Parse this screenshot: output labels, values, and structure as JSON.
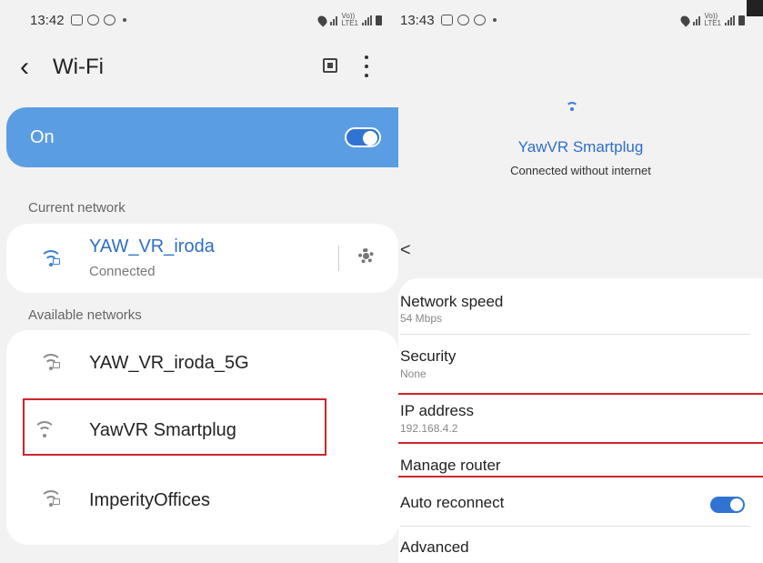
{
  "left": {
    "status": {
      "time": "13:42",
      "network_label": "Vo))\nLTE1"
    },
    "title": "Wi-Fi",
    "master_switch": {
      "label": "On",
      "state": "on"
    },
    "current_section_label": "Current network",
    "current_network": {
      "name": "YAW_VR_iroda",
      "status": "Connected"
    },
    "available_section_label": "Available networks",
    "networks": [
      {
        "name": "YAW_VR_iroda_5G",
        "icon": "wifi-lock-icon"
      },
      {
        "name": "YawVR Smartplug",
        "icon": "wifi-icon"
      },
      {
        "name": "ImperityOffices",
        "icon": "wifi-lock-icon"
      }
    ]
  },
  "right": {
    "status": {
      "time": "13:43",
      "network_label": "Vo))\nLTE1"
    },
    "network_name": "YawVR Smartplug",
    "network_status": "Connected without internet",
    "back": "<",
    "details": [
      {
        "label": "Network speed",
        "value": "54 Mbps"
      },
      {
        "label": "Security",
        "value": "None"
      },
      {
        "label": "IP address",
        "value": "192.168.4.2"
      },
      {
        "label": "Manage router",
        "value": ""
      },
      {
        "label": "Auto reconnect",
        "value": ""
      },
      {
        "label": "Advanced",
        "value": ""
      }
    ],
    "auto_reconnect": "on"
  },
  "colors": {
    "accent": "#3a7fd8",
    "on_card": "#5b9de3",
    "highlight": "#d0242b"
  }
}
